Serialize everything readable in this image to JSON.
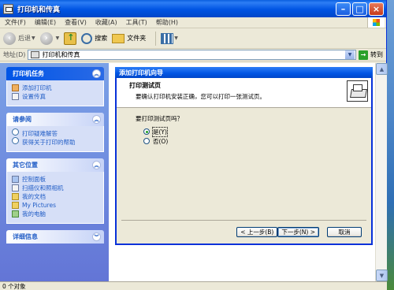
{
  "window": {
    "title": "打印机和传真"
  },
  "menu": [
    "文件(F)",
    "编辑(E)",
    "查看(V)",
    "收藏(A)",
    "工具(T)",
    "帮助(H)"
  ],
  "toolbar": {
    "back": "后退",
    "search": "搜索",
    "folders": "文件夹"
  },
  "address": {
    "label": "地址(D)",
    "value": "打印机和传真",
    "go": "转到"
  },
  "panels": {
    "printer_tasks": {
      "title": "打印机任务",
      "items": [
        "添加打印机",
        "设置传真"
      ]
    },
    "see_also": {
      "title": "请参阅",
      "items": [
        "打印疑难解答",
        "获得关于打印的帮助"
      ]
    },
    "other_places": {
      "title": "其它位置",
      "items": [
        "控制面板",
        "扫描仪和照相机",
        "我的文档",
        "My Pictures",
        "我的电脑"
      ]
    },
    "details": {
      "title": "详细信息"
    }
  },
  "wizard": {
    "title": "添加打印机向导",
    "heading": "打印测试页",
    "subheading": "要确认打印机安装正确，您可以打印一张测试页。",
    "question": "要打印测试页吗？",
    "options": [
      "是(Y)",
      "否(O)"
    ],
    "selected": 0,
    "buttons": {
      "back": "< 上一步(B)",
      "next": "下一步(N) >",
      "cancel": "取消"
    }
  },
  "status": {
    "text": "0 个对象"
  }
}
